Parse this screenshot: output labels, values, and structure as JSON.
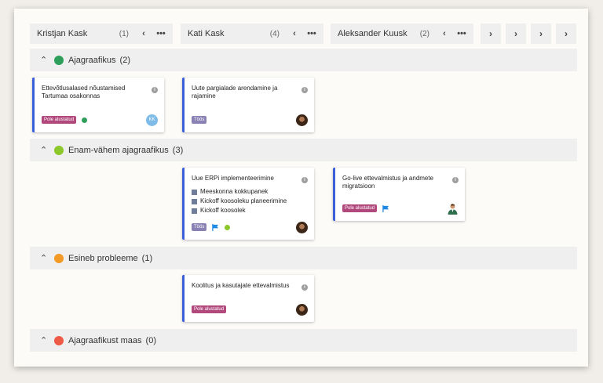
{
  "columns": [
    {
      "name": "Kristjan Kask",
      "count": "(1)",
      "prev_icon": "chevron-left",
      "more_icon": "ellipsis",
      "more_label": "•••",
      "prev_label": "‹"
    },
    {
      "name": "Kati Kask",
      "count": "(4)",
      "prev_icon": "chevron-left",
      "more_icon": "ellipsis",
      "more_label": "•••",
      "prev_label": "‹"
    },
    {
      "name": "Aleksander Kuusk",
      "count": "(2)",
      "prev_icon": "chevron-left",
      "more_icon": "ellipsis",
      "more_label": "•••",
      "prev_label": "‹"
    }
  ],
  "nav": {
    "next_label": "›"
  },
  "groups": [
    {
      "label": "Ajagraafikus",
      "count": "(2)",
      "color": "#2e9e5b",
      "chevron": "^"
    },
    {
      "label": "Enam-vähem ajagraafikus",
      "count": "(3)",
      "color": "#8cc82b",
      "chevron": "^"
    },
    {
      "label": "Esineb probleeme",
      "count": "(1)",
      "color": "#f39a26",
      "chevron": "^"
    },
    {
      "label": "Ajagraafikust maas",
      "count": "(0)",
      "color": "#ee5a45",
      "chevron": "^"
    }
  ],
  "cards": {
    "c1": {
      "title": "Ettevõtlusalased nõustamised Tartumaa osakonnas",
      "badge": "Pole alustatud",
      "avatar_initials": "KK",
      "dot_color": "#2e9e5b"
    },
    "c2": {
      "title": "Uute pargialade arendamine ja rajamine",
      "badge": "Töös"
    },
    "c3": {
      "title": "Uue ERPi implementeerimine",
      "badge": "Töös",
      "dot_color": "#8cc82b",
      "checklist": [
        "Meeskonna kokkupanek",
        "Kickoff koosoleku planeerimine",
        "Kickoff koosolek"
      ]
    },
    "c4": {
      "title": "Go-live ettevalmistus ja andmete migratsioon",
      "badge": "Pole alustatud"
    },
    "c5": {
      "title": "Koolitus ja kasutajate ettevalmistus",
      "badge": "Pole alustatud"
    }
  },
  "info_label": "i",
  "colors": {
    "accent": "#3b5fd6",
    "badge_not_started": "#b2497d",
    "badge_in_progress": "#8a82b4",
    "flag": "#1e88e5"
  }
}
